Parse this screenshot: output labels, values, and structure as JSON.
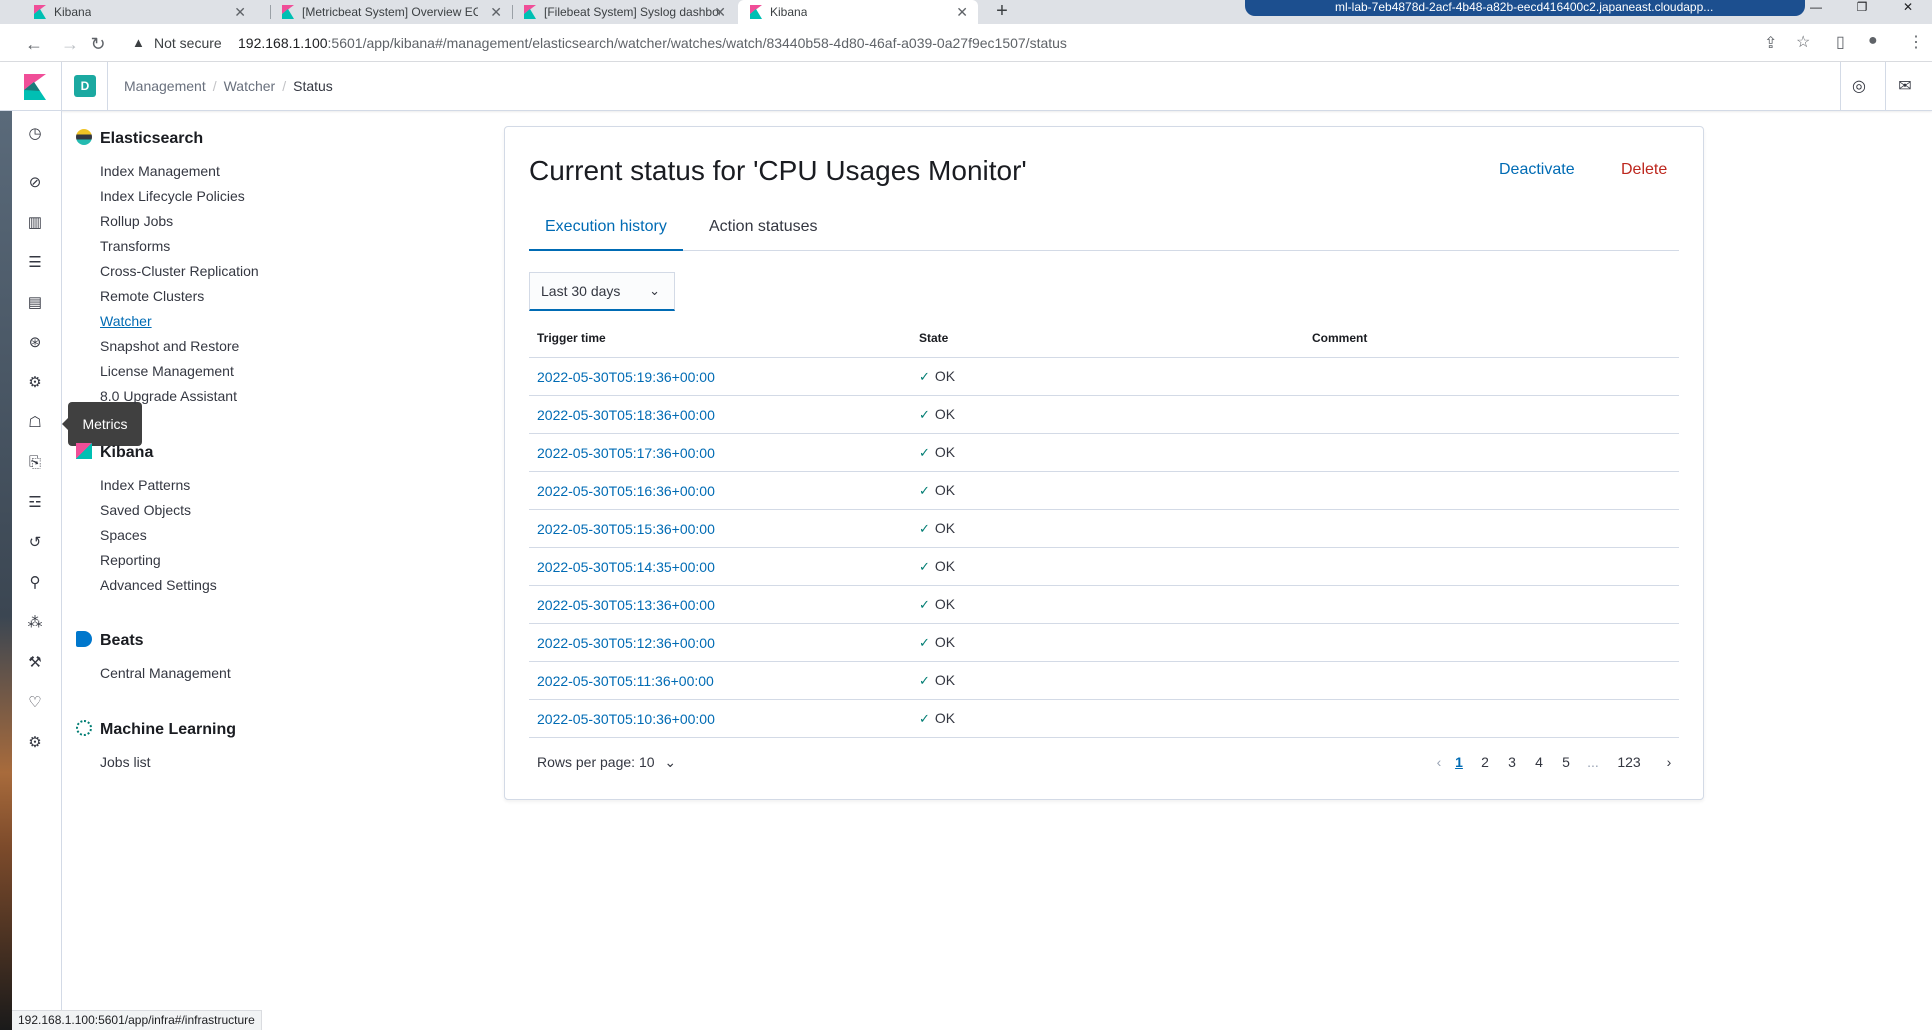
{
  "browser": {
    "tabs": [
      {
        "title": "Kibana",
        "active": false
      },
      {
        "title": "[Metricbeat System] Overview EC",
        "active": false
      },
      {
        "title": "[Filebeat System] Syslog dashboa",
        "active": false
      },
      {
        "title": "Kibana",
        "active": true
      }
    ],
    "new_tab": "+",
    "remote_session": "ml-lab-7eb4878d-2acf-4b48-a82b-eecd416400c2.japaneast.cloudapp...",
    "security_label": "Not secure",
    "url_host": "192.168.1.100",
    "url_rest": ":5601/app/kibana#/management/elasticsearch/watcher/watches/watch/83440b58-4d80-46af-a039-0a27f9ec1507/status",
    "status_url": "192.168.1.100:5601/app/infra#/infrastructure"
  },
  "header": {
    "space_initial": "D",
    "breadcrumbs": [
      "Management",
      "Watcher",
      "Status"
    ]
  },
  "tooltip": "Metrics",
  "sidenav": {
    "elasticsearch": {
      "title": "Elasticsearch",
      "items": [
        "Index Management",
        "Index Lifecycle Policies",
        "Rollup Jobs",
        "Transforms",
        "Cross-Cluster Replication",
        "Remote Clusters",
        "Watcher",
        "Snapshot and Restore",
        "License Management",
        "8.0 Upgrade Assistant"
      ],
      "active": "Watcher"
    },
    "kibana": {
      "title": "Kibana",
      "items": [
        "Index Patterns",
        "Saved Objects",
        "Spaces",
        "Reporting",
        "Advanced Settings"
      ]
    },
    "beats": {
      "title": "Beats",
      "items": [
        "Central Management"
      ]
    },
    "ml": {
      "title": "Machine Learning",
      "items": [
        "Jobs list"
      ]
    }
  },
  "page": {
    "title": "Current status for 'CPU Usages Monitor'",
    "deactivate": "Deactivate",
    "delete": "Delete",
    "tabs": [
      "Execution history",
      "Action statuses"
    ],
    "range": "Last 30 days",
    "columns": [
      "Trigger time",
      "State",
      "Comment"
    ],
    "rows": [
      {
        "time": "2022-05-30T05:19:36+00:00",
        "state": "OK",
        "comment": ""
      },
      {
        "time": "2022-05-30T05:18:36+00:00",
        "state": "OK",
        "comment": ""
      },
      {
        "time": "2022-05-30T05:17:36+00:00",
        "state": "OK",
        "comment": ""
      },
      {
        "time": "2022-05-30T05:16:36+00:00",
        "state": "OK",
        "comment": ""
      },
      {
        "time": "2022-05-30T05:15:36+00:00",
        "state": "OK",
        "comment": ""
      },
      {
        "time": "2022-05-30T05:14:35+00:00",
        "state": "OK",
        "comment": ""
      },
      {
        "time": "2022-05-30T05:13:36+00:00",
        "state": "OK",
        "comment": ""
      },
      {
        "time": "2022-05-30T05:12:36+00:00",
        "state": "OK",
        "comment": ""
      },
      {
        "time": "2022-05-30T05:11:36+00:00",
        "state": "OK",
        "comment": ""
      },
      {
        "time": "2022-05-30T05:10:36+00:00",
        "state": "OK",
        "comment": ""
      }
    ],
    "rows_per_page": "Rows per page: 10",
    "pages": [
      "1",
      "2",
      "3",
      "4",
      "5",
      "...",
      "123"
    ],
    "current_page": "1"
  },
  "colors": {
    "link": "#006bb4",
    "danger": "#bd271e",
    "success": "#017d73",
    "space_avatar": "#1ba9a1"
  }
}
